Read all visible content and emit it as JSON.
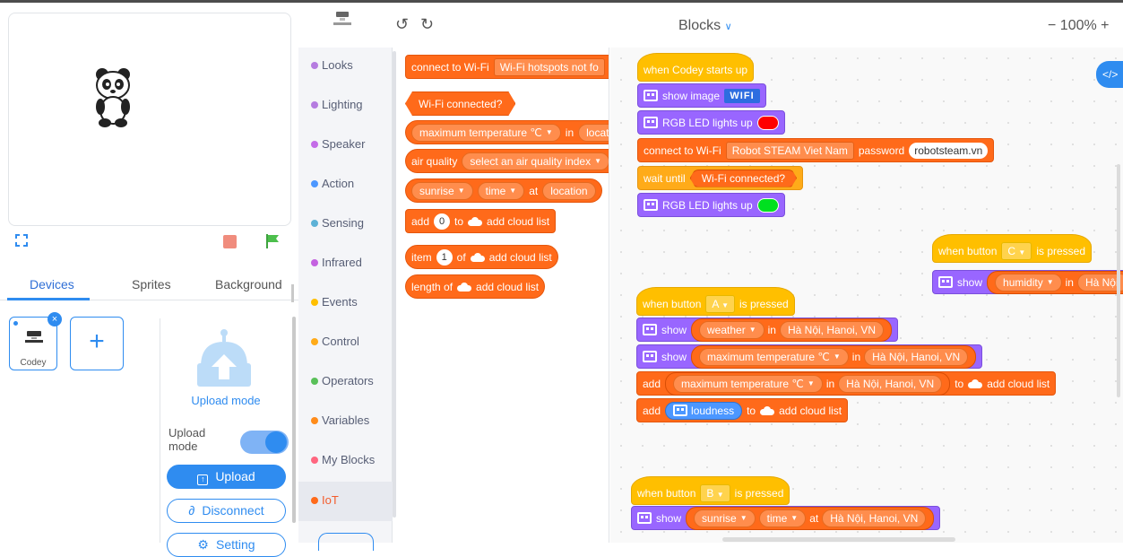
{
  "stage_tabs": {
    "devices": "Devices",
    "sprites": "Sprites",
    "background": "Background"
  },
  "devices": {
    "selected_device": "Codey",
    "add_symbol": "+"
  },
  "upload": {
    "mode_title": "Upload mode",
    "mode_label": "Upload mode",
    "toggle_on": true,
    "upload_btn": "Upload",
    "disconnect_btn": "Disconnect",
    "setting_btn": "Setting"
  },
  "toolbar": {
    "title": "Blocks",
    "zoom_minus": "−",
    "zoom_value": "100%",
    "zoom_plus": "+"
  },
  "categories": [
    {
      "label": "Looks",
      "color": "#b57ce0"
    },
    {
      "label": "Lighting",
      "color": "#b57ce0"
    },
    {
      "label": "Speaker",
      "color": "#c46ce8"
    },
    {
      "label": "Action",
      "color": "#4c97ff"
    },
    {
      "label": "Sensing",
      "color": "#5cb1d6"
    },
    {
      "label": "Infrared",
      "color": "#c462e0"
    },
    {
      "label": "Events",
      "color": "#ffbf00"
    },
    {
      "label": "Control",
      "color": "#ffab19"
    },
    {
      "label": "Operators",
      "color": "#59c059"
    },
    {
      "label": "Variables",
      "color": "#ff8c1a"
    },
    {
      "label": "My Blocks",
      "color": "#ff6680"
    },
    {
      "label": "IoT",
      "color": "#ff6a1a"
    }
  ],
  "flyout": {
    "connect": "connect to Wi-Fi",
    "hotspot": "Wi-Fi hotspots not fo",
    "wifi_connected": "Wi-Fi connected?",
    "max_temp": "maximum temperature ℃",
    "in": "in",
    "locat": "locat",
    "air_quality": "air quality",
    "aq_select": "select an air quality index",
    "sunrise": "sunrise",
    "time": "time",
    "at": "at",
    "location": "location",
    "add": "add",
    "zero": "0",
    "to": "to",
    "add_cloud_list": "add cloud list",
    "item": "item",
    "one": "1",
    "of": "of",
    "length_of": "length of"
  },
  "canvas": {
    "when_codey": "when Codey starts up",
    "show_image": "show image",
    "wifi_text": "WIFI",
    "rgb_led": "RGB LED lights up",
    "led_red": "#ff0000",
    "led_green": "#00e020",
    "connect": "connect to Wi-Fi",
    "ssid": "Robot STEAM Viet Nam",
    "password": "password",
    "pwd_value": "robotsteam.vn",
    "wait_until": "wait until",
    "wifi_connected": "Wi-Fi connected?",
    "when_button": "when button",
    "is_pressed": "is pressed",
    "btn_a": "A",
    "btn_b": "B",
    "btn_c": "C",
    "show": "show",
    "weather": "weather",
    "in": "in",
    "hanoi": "Hà Nội, Hanoi, VN",
    "hanoi_cut": "Hà Nội,",
    "max_temp": "maximum temperature ℃",
    "add": "add",
    "to": "to",
    "add_cloud_list": "add cloud list",
    "loudness": "loudness",
    "humidity": "humidity",
    "sunrise": "sunrise",
    "time": "time",
    "at": "at",
    "code_icon": "</>"
  }
}
